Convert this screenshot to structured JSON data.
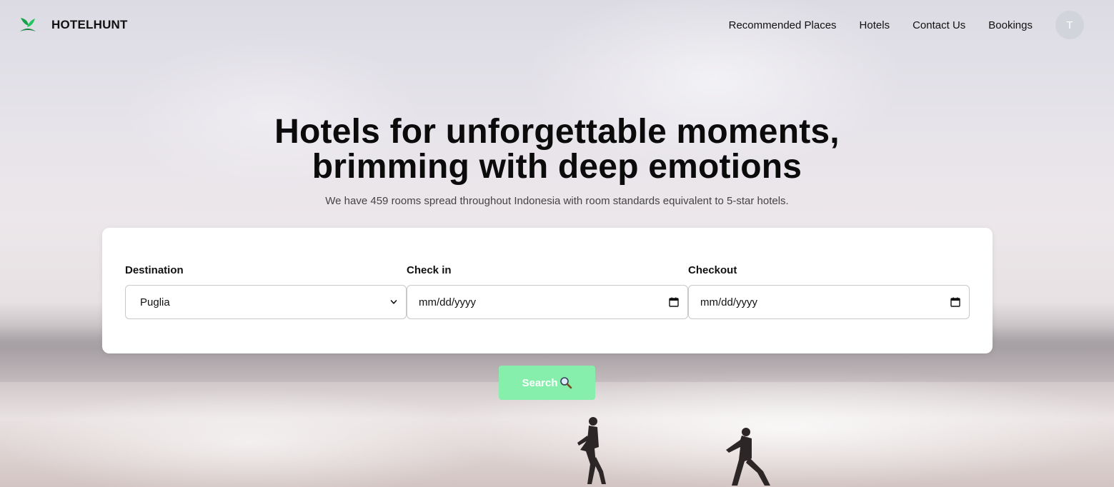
{
  "brand": {
    "name": "HOTELHUNT"
  },
  "nav": {
    "links": [
      "Recommended Places",
      "Hotels",
      "Contact Us",
      "Bookings"
    ],
    "avatar_initial": "T"
  },
  "hero": {
    "title_line1": "Hotels for unforgettable moments,",
    "title_line2": "brimming with deep emotions",
    "subtitle": "We have 459 rooms spread throughout Indonesia with room standards equivalent to 5-star hotels."
  },
  "search": {
    "destination_label": "Destination",
    "destination_value": "Puglia",
    "checkin_label": "Check in",
    "checkin_placeholder": "mm/dd/yyyy",
    "checkout_label": "Checkout",
    "checkout_placeholder": "mm/dd/yyyy",
    "button_label": "Search"
  },
  "colors": {
    "accent": "#86efac",
    "avatar_bg": "#d1d5db",
    "logo_green": "#16a34a"
  },
  "icons": [
    "leaf-logo-icon",
    "chevron-down-icon",
    "calendar-icon",
    "magnifier-icon"
  ]
}
